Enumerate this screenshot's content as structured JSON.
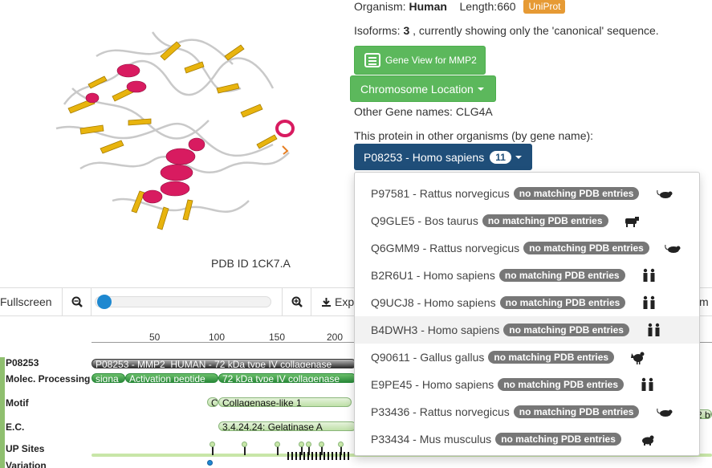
{
  "header": {
    "organism_label": "Organism:",
    "organism_value": "Human",
    "length_label": "Length:660",
    "uniprot_label": "UniProt",
    "isoforms_prefix": "Isoforms:",
    "isoforms_count": "3",
    "isoforms_suffix": ", currently showing only the 'canonical' sequence."
  },
  "buttons": {
    "gene_view": "Gene View for MMP2",
    "chromosome": "Chromosome Location"
  },
  "other_gene_names": "Other Gene names: CLG4A",
  "other_orgs_label": "This protein in other organisms (by gene name):",
  "org_dropdown": {
    "label": "P08253 - Homo sapiens",
    "count": "11"
  },
  "org_menu": [
    {
      "text": "P97581 - Rattus norvegicus",
      "badge": "no matching PDB entries",
      "icon": "rat-icon"
    },
    {
      "text": "Q9GLE5 - Bos taurus",
      "badge": "no matching PDB entries",
      "icon": "cow-icon"
    },
    {
      "text": "Q6GMM9 - Rattus norvegicus",
      "badge": "no matching PDB entries",
      "icon": "rat-icon"
    },
    {
      "text": "B2R6U1 - Homo sapiens",
      "badge": "no matching PDB entries",
      "icon": "human-pair-icon"
    },
    {
      "text": "Q9UCJ8 - Homo sapiens",
      "badge": "no matching PDB entries",
      "icon": "human-pair-icon"
    },
    {
      "text": "B4DWH3 - Homo sapiens",
      "badge": "no matching PDB entries",
      "icon": "human-pair-icon"
    },
    {
      "text": "Q90611 - Gallus gallus",
      "badge": "no matching PDB entries",
      "icon": "chicken-icon"
    },
    {
      "text": "E9PE45 - Homo sapiens",
      "badge": "no matching PDB entries",
      "icon": "human-pair-icon"
    },
    {
      "text": "P33436 - Rattus norvegicus",
      "badge": "no matching PDB entries",
      "icon": "rat-icon"
    },
    {
      "text": "P33434 - Mus musculus",
      "badge": "no matching PDB entries",
      "icon": "mouse-icon"
    }
  ],
  "pdb_caption": "PDB ID 1CK7.A",
  "toolbar": {
    "fullscreen": "Fullscreen",
    "export": "Exp",
    "right_fragment": "m"
  },
  "ruler_ticks": [
    "50",
    "100",
    "150",
    "200"
  ],
  "tracks": {
    "p08253_label": "P08253",
    "molec_label": "Molec. Processing",
    "motif_label": "Motif",
    "ec_label": "E.C.",
    "upsites_label": "UP Sites",
    "variation_label": "Variation"
  },
  "features": {
    "main_bar": "P08253 - MMP2_HUMAN - 72 kDa type IV collagenase",
    "signal": "signa",
    "activation": "Activation peptide",
    "collagenase72": "72 kDa type IV collagenase",
    "motif_c": "C",
    "motif_collagenase": "Collagenase-like 1",
    "ec": "3.4.24.24: Gelatinase A",
    "right_fragment": "2 bi"
  },
  "colors": {
    "green_button": "#5cb85c",
    "dropdown_blue": "#1f4e79",
    "uniprot_orange": "#e69a34",
    "badge_gray": "#777777",
    "helix_magenta": "#d81b60",
    "sheet_gold": "#e8b40e"
  }
}
